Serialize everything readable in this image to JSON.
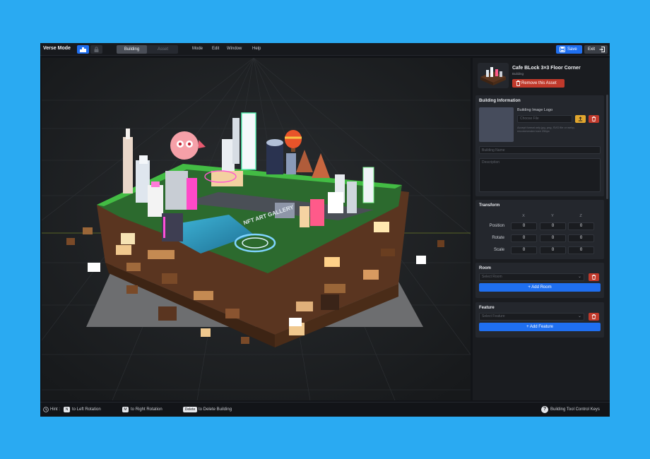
{
  "topbar": {
    "brand": "Verse Mode",
    "tabs": [
      {
        "label": "Building"
      },
      {
        "label": "Asset"
      }
    ],
    "menu": [
      "Mode",
      "Edit",
      "Window",
      "Help"
    ],
    "save_label": "Save",
    "exit_label": "Exit"
  },
  "asset": {
    "title": "Cafe BLock 3×3 Floor Corner",
    "category": "Building",
    "remove_label": "Remove this Asset"
  },
  "building_info": {
    "title": "Building Information",
    "logo_label": "Building Image Logo",
    "file_placeholder": "Choose File",
    "file_hint": "Accept format only jpg, png, SVG file or webp, recommended size 256px",
    "name_placeholder": "Building Name",
    "description_placeholder": "Description"
  },
  "transform": {
    "title": "Transform",
    "columns": [
      "X",
      "Y",
      "Z"
    ],
    "rows": [
      {
        "label": "Position",
        "values": [
          "0",
          "0",
          "0"
        ]
      },
      {
        "label": "Rotate",
        "values": [
          "0",
          "0",
          "0"
        ]
      },
      {
        "label": "Scale",
        "values": [
          "0",
          "0",
          "0"
        ]
      }
    ]
  },
  "room": {
    "title": "Room",
    "select_placeholder": "Select Room",
    "add_label": "+ Add Room"
  },
  "feature": {
    "title": "Feature",
    "select_placeholder": "Select Feature",
    "add_label": "+ Add Feature"
  },
  "hints": {
    "prefix": "Hint :",
    "items": [
      {
        "key": "N",
        "text": "to Left Rotation"
      },
      {
        "key": "M",
        "text": "to Right Rotation"
      },
      {
        "key": "Delete",
        "text": "to Delete Building"
      }
    ],
    "help_label": "Building Tool Control Keys"
  },
  "scene": {
    "sign_text": "NFT ART GALLERY"
  },
  "colors": {
    "accent": "#1f6ff0",
    "danger": "#c0392b",
    "warning": "#e2a72e",
    "background": "#2aaaf2"
  },
  "icons": {
    "mode_active": "building-grid-icon",
    "mode_inactive": "lock-icon",
    "save": "floppy-icon",
    "exit": "logout-icon",
    "remove": "trash-icon",
    "upload": "upload-icon",
    "help": "question-icon"
  }
}
